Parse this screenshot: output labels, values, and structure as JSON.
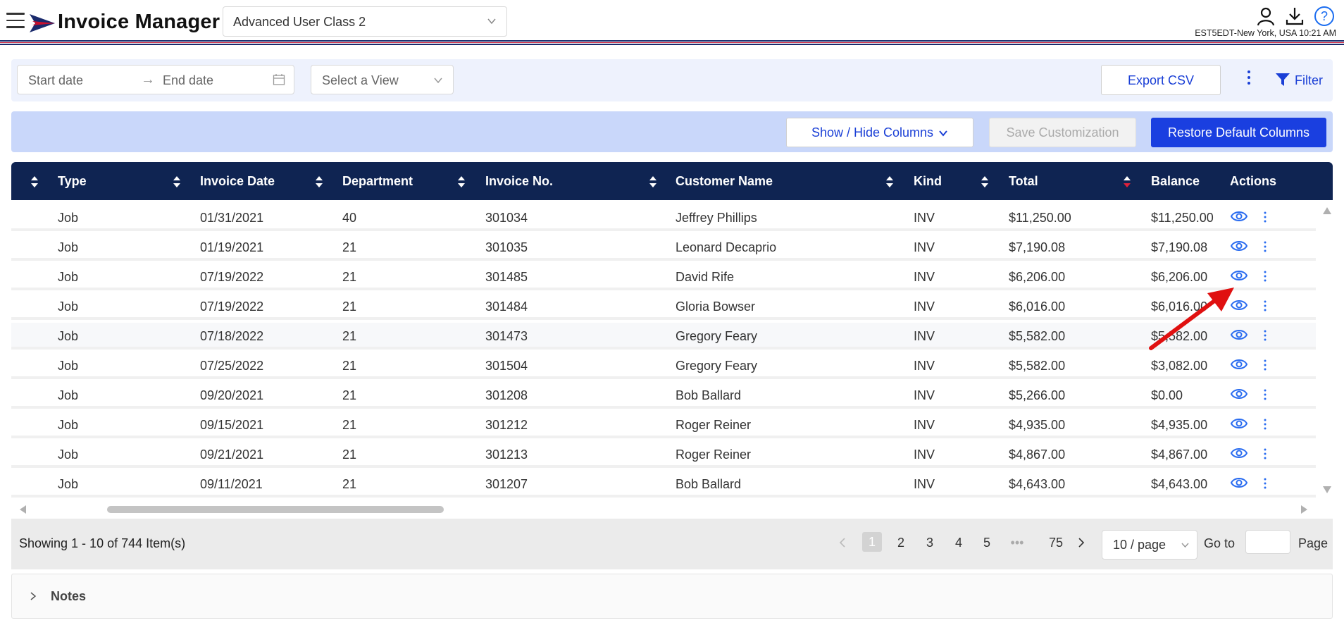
{
  "header": {
    "title": "Invoice Manager",
    "class_select": "Advanced User Class 2",
    "timezone": "EST5EDT-New York, USA 10:21 AM",
    "stripe_colors": [
      "#1a2a6c",
      "#c8102e",
      "#1a2a6c"
    ]
  },
  "filters": {
    "start_placeholder": "Start date",
    "end_placeholder": "End date",
    "view_placeholder": "Select a View",
    "export_label": "Export CSV",
    "filter_label": "Filter"
  },
  "columns_bar": {
    "show_hide_label": "Show / Hide Columns",
    "save_label": "Save Customization",
    "restore_label": "Restore Default Columns"
  },
  "table": {
    "headers": [
      "Type",
      "Invoice Date",
      "Department",
      "Invoice No.",
      "Customer Name",
      "Kind",
      "Total",
      "Balance",
      "Actions"
    ],
    "rows": [
      {
        "type": "Job",
        "date": "01/31/2021",
        "dept": "40",
        "invoice": "301034",
        "customer": "Jeffrey Phillips",
        "kind": "INV",
        "total": "$11,250.00",
        "balance": "$11,250.00"
      },
      {
        "type": "Job",
        "date": "01/19/2021",
        "dept": "21",
        "invoice": "301035",
        "customer": "Leonard Decaprio",
        "kind": "INV",
        "total": "$7,190.08",
        "balance": "$7,190.08"
      },
      {
        "type": "Job",
        "date": "07/19/2022",
        "dept": "21",
        "invoice": "301485",
        "customer": "David Rife",
        "kind": "INV",
        "total": "$6,206.00",
        "balance": "$6,206.00"
      },
      {
        "type": "Job",
        "date": "07/19/2022",
        "dept": "21",
        "invoice": "301484",
        "customer": "Gloria Bowser",
        "kind": "INV",
        "total": "$6,016.00",
        "balance": "$6,016.00"
      },
      {
        "type": "Job",
        "date": "07/18/2022",
        "dept": "21",
        "invoice": "301473",
        "customer": "Gregory Feary",
        "kind": "INV",
        "total": "$5,582.00",
        "balance": "$5,582.00"
      },
      {
        "type": "Job",
        "date": "07/25/2022",
        "dept": "21",
        "invoice": "301504",
        "customer": "Gregory Feary",
        "kind": "INV",
        "total": "$5,582.00",
        "balance": "$3,082.00"
      },
      {
        "type": "Job",
        "date": "09/20/2021",
        "dept": "21",
        "invoice": "301208",
        "customer": "Bob Ballard",
        "kind": "INV",
        "total": "$5,266.00",
        "balance": "$0.00"
      },
      {
        "type": "Job",
        "date": "09/15/2021",
        "dept": "21",
        "invoice": "301212",
        "customer": "Roger Reiner",
        "kind": "INV",
        "total": "$4,935.00",
        "balance": "$4,935.00"
      },
      {
        "type": "Job",
        "date": "09/21/2021",
        "dept": "21",
        "invoice": "301213",
        "customer": "Roger Reiner",
        "kind": "INV",
        "total": "$4,867.00",
        "balance": "$4,867.00"
      },
      {
        "type": "Job",
        "date": "09/11/2021",
        "dept": "21",
        "invoice": "301207",
        "customer": "Bob Ballard",
        "kind": "INV",
        "total": "$4,643.00",
        "balance": "$4,643.00"
      }
    ]
  },
  "pagination": {
    "showing": "Showing 1 - 10 of 744 Item(s)",
    "pages": [
      "1",
      "2",
      "3",
      "4",
      "5"
    ],
    "ellipsis": "•••",
    "last": "75",
    "page_size": "10 / page",
    "goto_label": "Go to",
    "page_label": "Page"
  },
  "notes": {
    "label": "Notes"
  },
  "colors": {
    "header_bg": "#0f2452",
    "accent": "#1a3fd6",
    "primary_button": "#1a3fe0",
    "eye_icon": "#2a6cf0",
    "annotation_arrow": "#e01010"
  }
}
